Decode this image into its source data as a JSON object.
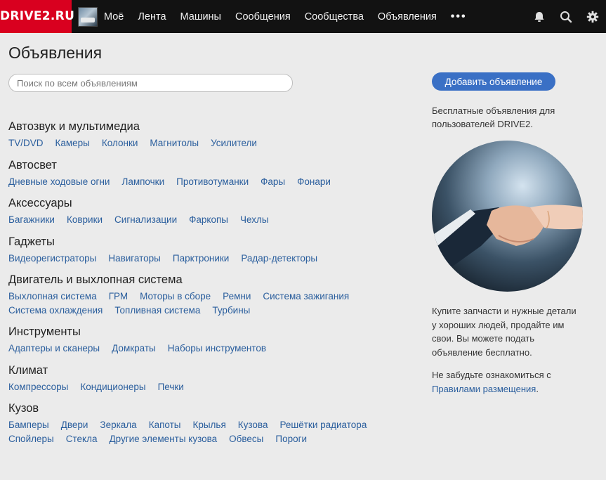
{
  "header": {
    "logo": "DRIVE2.RU",
    "nav": [
      "Моё",
      "Лента",
      "Машины",
      "Сообщения",
      "Сообщества",
      "Объявления"
    ],
    "more": "•••",
    "icons": [
      "bell-icon",
      "search-icon",
      "gear-icon"
    ]
  },
  "page": {
    "title": "Объявления",
    "search_placeholder": "Поиск по всем объявлениям"
  },
  "categories": [
    {
      "title": "Автозвук и мультимедиа",
      "rows": [
        [
          "TV/DVD",
          "Камеры",
          "Колонки",
          "Магнитолы",
          "Усилители"
        ]
      ]
    },
    {
      "title": "Автосвет",
      "rows": [
        [
          "Дневные ходовые огни",
          "Лампочки",
          "Противотуманки",
          "Фары",
          "Фонари"
        ]
      ]
    },
    {
      "title": "Аксессуары",
      "rows": [
        [
          "Багажники",
          "Коврики",
          "Сигнализации",
          "Фаркопы",
          "Чехлы"
        ]
      ]
    },
    {
      "title": "Гаджеты",
      "rows": [
        [
          "Видеорегистраторы",
          "Навигаторы",
          "Парктроники",
          "Радар-детекторы"
        ]
      ]
    },
    {
      "title": "Двигатель и выхлопная система",
      "rows": [
        [
          "Выхлопная система",
          "ГРМ",
          "Моторы в сборе",
          "Ремни",
          "Система зажигания"
        ],
        [
          "Система охлаждения",
          "Топливная система",
          "Турбины"
        ]
      ]
    },
    {
      "title": "Инструменты",
      "rows": [
        [
          "Адаптеры и сканеры",
          "Домкраты",
          "Наборы инструментов"
        ]
      ]
    },
    {
      "title": "Климат",
      "rows": [
        [
          "Компрессоры",
          "Кондиционеры",
          "Печки"
        ]
      ]
    },
    {
      "title": "Кузов",
      "rows": [
        [
          "Бамперы",
          "Двери",
          "Зеркала",
          "Капоты",
          "Крылья",
          "Кузова",
          "Решётки радиатора"
        ],
        [
          "Спойлеры",
          "Стекла",
          "Другие элементы кузова",
          "Обвесы",
          "Пороги"
        ]
      ]
    }
  ],
  "sidebar": {
    "add_button": "Добавить объявление",
    "promo": "Бесплатные объявления для пользователей DRIVE2.",
    "info": "Купите запчасти и нужные детали у хороших людей, продайте им свои. Вы можете подать объявление бесплатно.",
    "rules_prefix": "Не забудьте ознакомиться с ",
    "rules_link": "Правилами размещения",
    "rules_suffix": "."
  },
  "colors": {
    "accent": "#d9001f",
    "link": "#2a5e9d",
    "button": "#3a70c5"
  }
}
